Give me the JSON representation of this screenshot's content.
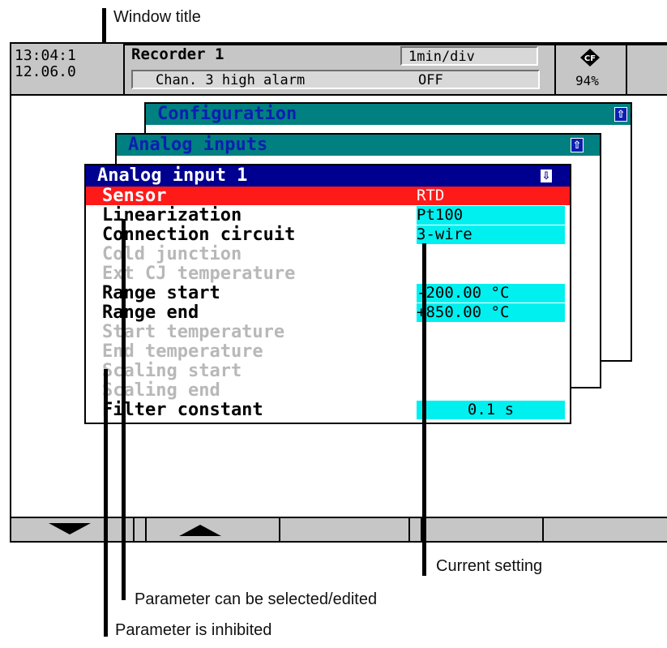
{
  "callouts": {
    "window_title": "Window title",
    "current_setting": "Current setting",
    "selectable": "Parameter can be selected/edited",
    "inhibited": "Parameter is inhibited"
  },
  "header": {
    "time": "13:04:1",
    "date": "12.06.0",
    "recorder": "Recorder 1",
    "timebase": "1min/div",
    "alarm_text": "Chan. 3 high alarm",
    "alarm_state": "OFF",
    "memory_percent": "94%",
    "memory_icon": "cf-card-icon"
  },
  "windows": {
    "configuration": "Configuration",
    "analog_inputs": "Analog inputs",
    "analog_input_1": "Analog input 1"
  },
  "parameters": [
    {
      "label": "Sensor",
      "value": "RTD",
      "state": "selected"
    },
    {
      "label": "Linearization",
      "value": "Pt100",
      "state": "editable"
    },
    {
      "label": "Connection circuit",
      "value": "3-wire",
      "state": "editable"
    },
    {
      "label": "Cold junction",
      "value": "",
      "state": "inhibited"
    },
    {
      "label": "Ext CJ temperature",
      "value": "",
      "state": "inhibited"
    },
    {
      "label": "Range start",
      "value": "-200.00 °C",
      "state": "editable"
    },
    {
      "label": "Range end",
      "value": "+850.00 °C",
      "state": "editable"
    },
    {
      "label": "Start temperature",
      "value": "",
      "state": "inhibited"
    },
    {
      "label": "End temperature",
      "value": "",
      "state": "inhibited"
    },
    {
      "label": "Scaling start",
      "value": "",
      "state": "inhibited"
    },
    {
      "label": "Scaling end",
      "value": "",
      "state": "inhibited"
    },
    {
      "label": "Filter constant",
      "value": "0.1 s",
      "state": "editable"
    }
  ],
  "softkeys": [
    "down-arrow-icon",
    "up-arrow-icon",
    "",
    "",
    ""
  ],
  "colors": {
    "title_bar": "#000090",
    "back_title_bar": "#008080",
    "selected_row": "#ff1a1a",
    "value_field": "#00f0f0",
    "inhibited_text": "#b8b8b8"
  }
}
